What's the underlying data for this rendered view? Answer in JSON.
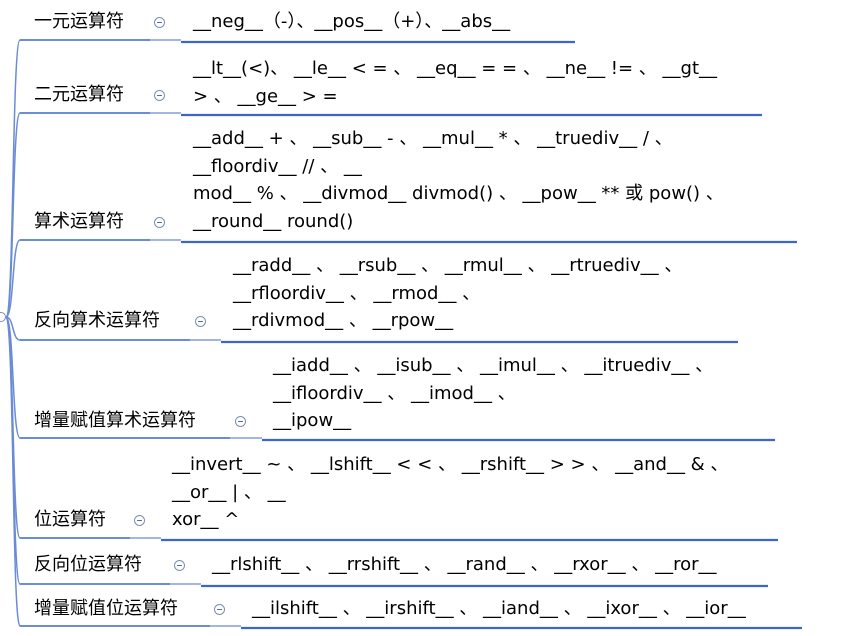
{
  "branches": [
    {
      "label": "一元运算符",
      "lines": [
        "__neg__（-）、__pos__（+）、__abs__"
      ]
    },
    {
      "label": "二元运算符",
      "lines": [
        "__lt__(<)、 __le__ < = 、 __eq__ = = 、 __ne__ != 、 __gt__",
        "> 、 __ge__ > ="
      ]
    },
    {
      "label": "算术运算符",
      "lines": [
        "__add__ + 、 __sub__ - 、 __mul__ * 、 __truediv__ / 、",
        "__floordiv__ // 、 __",
        "mod__ % 、 __divmod__ divmod() 、 __pow__ ** 或 pow() 、",
        "__round__ round()"
      ]
    },
    {
      "label": "反向算术运算符",
      "lines": [
        "__radd__ 、 __rsub__ 、 __rmul__ 、 __rtruediv__ 、",
        "__rfloordiv__ 、 __rmod__ 、",
        "__rdivmod__ 、 __rpow__"
      ]
    },
    {
      "label": "增量赋值算术运算符",
      "lines": [
        "__iadd__ 、 __isub__ 、 __imul__ 、 __itruediv__ 、",
        "__ifloordiv__ 、 __imod__ 、",
        "__ipow__"
      ]
    },
    {
      "label": "位运算符",
      "lines": [
        "__invert__ ~ 、 __lshift__ < < 、 __rshift__ > > 、 __and__ & 、",
        "__or__ | 、 __",
        "xor__ ^"
      ]
    },
    {
      "label": "反向位运算符",
      "lines": [
        "__rlshift__ 、 __rrshift__ 、 __rand__ 、 __rxor__ 、 __ror__"
      ]
    },
    {
      "label": "增量赋值位运算符",
      "lines": [
        "__ilshift__ 、 __irshift__ 、 __iand__ 、 __ixor__ 、 __ior__"
      ]
    }
  ],
  "colors": {
    "underline": "#3d66c9",
    "connector": "#6b8bd6",
    "collapse": "#7a8eb8"
  }
}
